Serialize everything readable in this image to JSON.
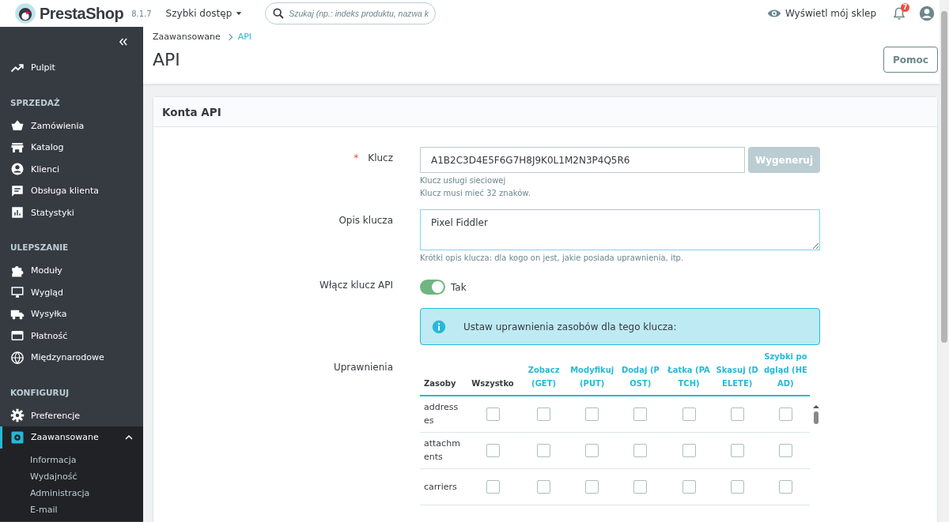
{
  "header": {
    "logo": "PrestaShop",
    "version": "8.1.7",
    "quick_access": "Szybki dostęp",
    "search": {
      "placeholder": "Szukaj (np.: indeks produktu, nazwa k"
    },
    "view_shop": "Wyświetl mój sklep",
    "notifications": "7"
  },
  "sidebar": {
    "items": [
      {
        "kind": "item",
        "label": "Pulpit",
        "selected": false
      },
      {
        "kind": "section",
        "label": "SPRZEDAŻ"
      },
      {
        "kind": "item",
        "label": "Zamówienia",
        "selected": false
      },
      {
        "kind": "item",
        "label": "Katalog",
        "selected": false
      },
      {
        "kind": "item",
        "label": "Klienci",
        "selected": false
      },
      {
        "kind": "item",
        "label": "Obsługa klienta",
        "selected": false
      },
      {
        "kind": "item",
        "label": "Statystyki",
        "selected": false
      },
      {
        "kind": "section",
        "label": "ULEPSZANIE"
      },
      {
        "kind": "item",
        "label": "Moduły",
        "selected": false
      },
      {
        "kind": "item",
        "label": "Wygląd",
        "selected": false
      },
      {
        "kind": "item",
        "label": "Wysyłka",
        "selected": false
      },
      {
        "kind": "item",
        "label": "Płatność",
        "selected": false
      },
      {
        "kind": "item",
        "label": "Międzynarodowe",
        "selected": false
      },
      {
        "kind": "section",
        "label": "KONFIGURUJ"
      },
      {
        "kind": "item",
        "label": "Preferencje",
        "selected": false
      },
      {
        "kind": "item",
        "label": "Zaawansowane",
        "selected": true,
        "expanded": true,
        "children": [
          {
            "label": "Informacja"
          },
          {
            "label": "Wydajność"
          },
          {
            "label": "Administracja"
          },
          {
            "label": "E-mail"
          }
        ]
      }
    ]
  },
  "breadcrumb": [
    {
      "label": "Zaawansowane",
      "selected": false
    },
    {
      "label": "API",
      "selected": true
    }
  ],
  "page_title": "API",
  "help_button": "Pomoc",
  "card": {
    "title": "Konta API",
    "key": {
      "label": "Klucz",
      "required_mark": "*",
      "value": "A1B2C3D4E5F6G7H8J9K0L1M2N3P4Q5R6",
      "button": "Wygeneruj",
      "button_disabled": true,
      "help": [
        "Klucz usługi sieciowej",
        "Klucz musi mieć 32 znaków."
      ]
    },
    "description": {
      "label": "Opis klucza",
      "value": "Pixel Fiddler",
      "help": "Krótki opis klucza: dla kogo on jest, jakie posiada uprawnienia, itp."
    },
    "enable": {
      "label": "Włącz klucz API",
      "on": true,
      "text": "Tak"
    },
    "info": "Ustaw uprawnienia zasobów dla tego klucza:",
    "permissions": {
      "label": "Uprawnienia",
      "columns": [
        {
          "label": "Zasoby",
          "kind": "plain"
        },
        {
          "label": "Wszystko",
          "kind": "plain"
        },
        {
          "label": "Zobacz (GET)",
          "kind": "method"
        },
        {
          "label": "Modyfikuj (PUT)",
          "kind": "method"
        },
        {
          "label": "Dodaj (POST)",
          "kind": "method"
        },
        {
          "label": "Łatka (PATCH)",
          "kind": "method"
        },
        {
          "label": "Skasuj (DELETE)",
          "kind": "method"
        },
        {
          "label": "Szybki podgląd (HEAD)",
          "kind": "method"
        }
      ],
      "rows": [
        {
          "resource": "addresses",
          "checked": [
            false,
            false,
            false,
            false,
            false,
            false,
            false
          ]
        },
        {
          "resource": "attachments",
          "checked": [
            false,
            false,
            false,
            false,
            false,
            false,
            false
          ]
        },
        {
          "resource": "carriers",
          "checked": [
            false,
            false,
            false,
            false,
            false,
            false,
            false
          ]
        }
      ]
    }
  }
}
